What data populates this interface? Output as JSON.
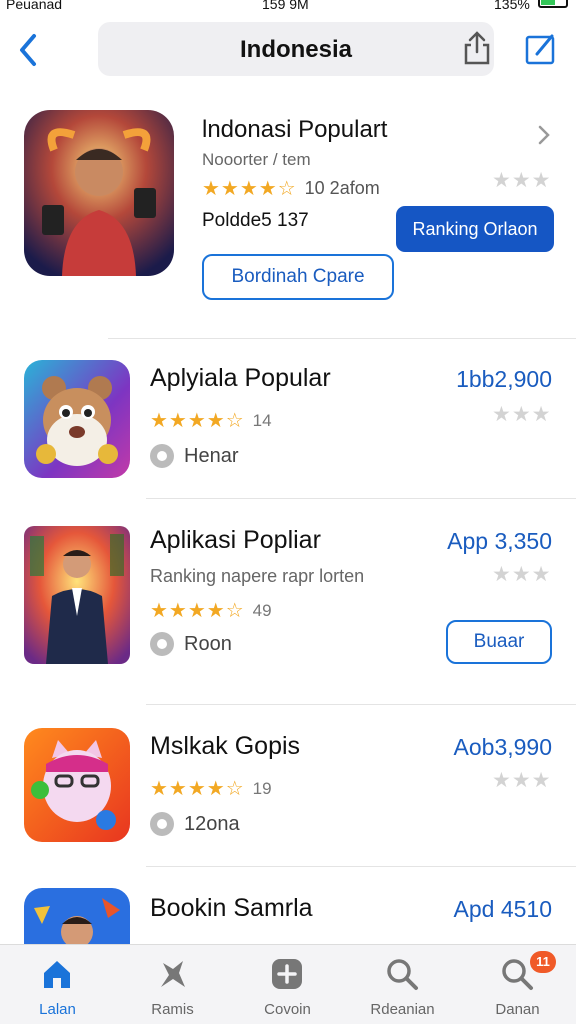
{
  "status_bar": {
    "carrier": "Peuanad",
    "time": "159 9M",
    "battery": "135%"
  },
  "header": {
    "title": "Indonesia",
    "back_icon": "chevron-left-icon",
    "share_icon": "share-icon",
    "compose_icon": "compose-icon"
  },
  "featured": {
    "title": "lndonasi Populart",
    "subtitle": "Nooorter / tem",
    "rating_text": "10 2afom",
    "price_text": "Poldde5 137",
    "ranking_button": "Ranking Orlaon",
    "secondary_button": "Bordinah Cpare"
  },
  "apps": [
    {
      "name": "Aplyiala Popular",
      "price": "1bb2,900",
      "rating_count": "14",
      "meta": "Henar",
      "description": ""
    },
    {
      "name": "Aplikasi Popliar",
      "price": "App 3,350",
      "rating_count": "49",
      "meta": "Roon",
      "description": "Ranking napere rapr lorten",
      "button": "Buaar"
    },
    {
      "name": "Mslkak Gopis",
      "price": "Aob3,990",
      "rating_count": "19",
      "meta": "12ona",
      "description": ""
    },
    {
      "name": "Bookin Samrla",
      "price": "Apd 4510",
      "rating_count": "",
      "meta": "",
      "description": ""
    }
  ],
  "tab_bar": {
    "tabs": [
      {
        "label": "Lalan",
        "icon": "home-icon",
        "active": true
      },
      {
        "label": "Ramis",
        "icon": "games-icon",
        "active": false
      },
      {
        "label": "Covoin",
        "icon": "add-icon",
        "active": false
      },
      {
        "label": "Rdeanian",
        "icon": "search-icon",
        "active": false
      },
      {
        "label": "Danan",
        "icon": "search-badge-icon",
        "active": false,
        "badge": "11"
      }
    ]
  },
  "colors": {
    "accent": "#1a73d9",
    "star": "#f2a823",
    "ranking_button": "#1556c4"
  }
}
